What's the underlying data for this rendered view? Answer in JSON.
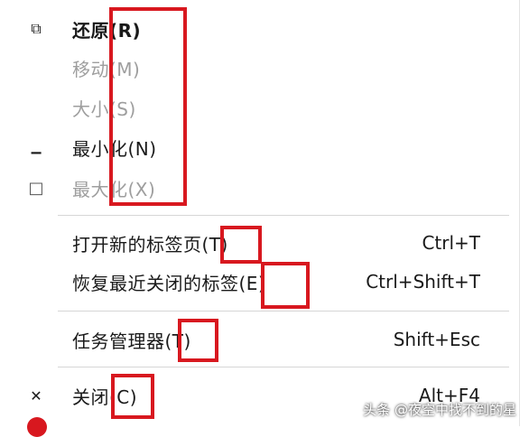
{
  "menu": {
    "items": [
      {
        "icon": "restore-icon",
        "icon_char": "⧉",
        "label": "还原(R)",
        "state": "bold"
      },
      {
        "icon": "",
        "icon_char": "",
        "label": "移动(M)",
        "state": "disabled"
      },
      {
        "icon": "",
        "icon_char": "",
        "label": "大小(S)",
        "state": "disabled"
      },
      {
        "icon": "minimize-icon",
        "icon_char": "▁",
        "label": "最小化(N)",
        "state": "normal"
      },
      {
        "icon": "maximize-icon",
        "icon_char": "□",
        "label": "最大化(X)",
        "state": "disabled"
      },
      {
        "icon": "",
        "icon_char": "",
        "label": "打开新的标签页(T)",
        "shortcut": "Ctrl+T",
        "state": "normal"
      },
      {
        "icon": "",
        "icon_char": "",
        "label": "恢复最近关闭的标签(E)",
        "shortcut": "Ctrl+Shift+T",
        "state": "normal"
      },
      {
        "icon": "",
        "icon_char": "",
        "label": "任务管理器(T)",
        "shortcut": "Shift+Esc",
        "state": "normal"
      },
      {
        "icon": "close-icon",
        "icon_char": "✕",
        "label": "关闭(C)",
        "shortcut": "Alt+F4",
        "state": "normal"
      }
    ]
  },
  "watermark": "头条 @夜空中找不到的星",
  "colors": {
    "highlight": "#d8181f",
    "disabled_text": "#9e9e9e",
    "separator": "#d6d6d6"
  }
}
